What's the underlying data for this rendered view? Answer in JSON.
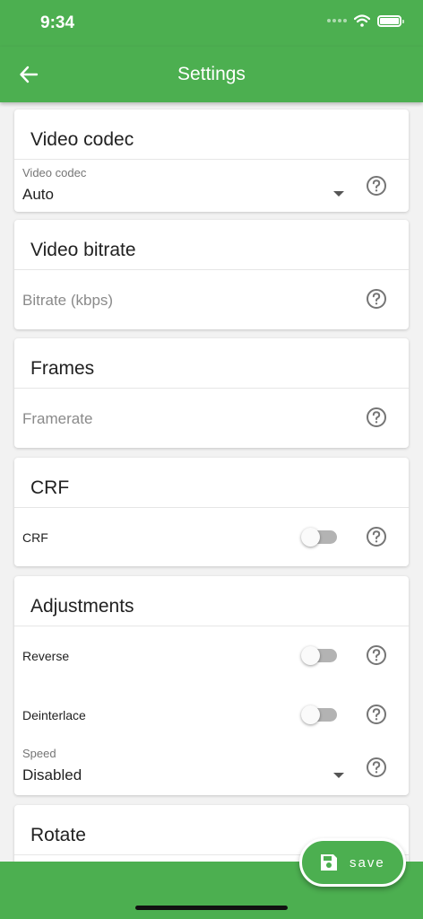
{
  "status_bar": {
    "time": "9:34",
    "icons": [
      "signal-dots-icon",
      "wifi-icon",
      "battery-icon"
    ]
  },
  "app_bar": {
    "title": "Settings",
    "back_icon": "arrow-left-icon"
  },
  "cards": {
    "video_codec": {
      "title": "Video codec",
      "field_label": "Video codec",
      "value": "Auto"
    },
    "video_bitrate": {
      "title": "Video bitrate",
      "placeholder": "Bitrate (kbps)"
    },
    "frames": {
      "title": "Frames",
      "placeholder": "Framerate"
    },
    "crf": {
      "title": "CRF",
      "toggle_label": "CRF",
      "toggle_on": false
    },
    "adjustments": {
      "title": "Adjustments",
      "reverse_label": "Reverse",
      "reverse_on": false,
      "deinterlace_label": "Deinterlace",
      "deinterlace_on": false,
      "speed_label": "Speed",
      "speed_value": "Disabled"
    },
    "rotate": {
      "title": "Rotate"
    }
  },
  "fab": {
    "label": "save",
    "icon": "floppy-disk-icon"
  },
  "colors": {
    "primary": "#4caf50",
    "toggle_off_track": "#b3b3b3",
    "help_icon": "#757575"
  }
}
